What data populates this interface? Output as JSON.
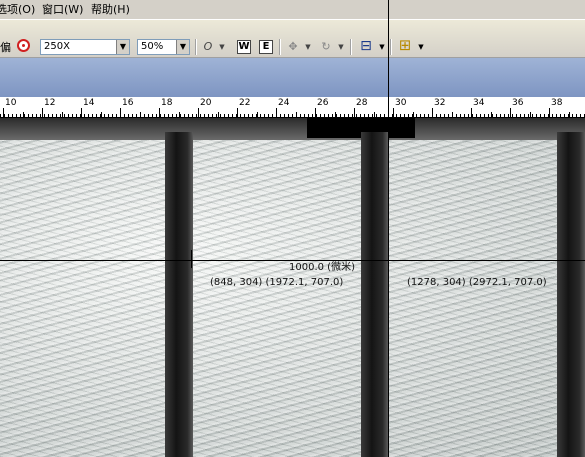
{
  "menu": {
    "items": [
      "选项(O)",
      "窗口(W)",
      "帮助(H)"
    ]
  },
  "toolbar": {
    "left_label": "偏",
    "magnification": "250X",
    "zoom": "50%",
    "buttons": {
      "o_label": "O",
      "w_label": "W",
      "e_label": "E",
      "move_label": "✥",
      "rotate_label": "↻",
      "measure_label": "⊟",
      "ruler_label": "⊞"
    }
  },
  "ruler": {
    "labels": [
      "10",
      "12",
      "14",
      "16",
      "18",
      "20",
      "22",
      "24",
      "26",
      "28",
      "30",
      "32",
      "34",
      "36",
      "38"
    ]
  },
  "measurement": {
    "distance": "1000.0 (微米)",
    "point1": "(848, 304)  (1972.1, 707.0)",
    "point2": "(1278, 304)  (2972.1, 707.0)"
  },
  "colors": {
    "accent_red": "#d02020",
    "strip_blue": "#8ea4cc"
  }
}
